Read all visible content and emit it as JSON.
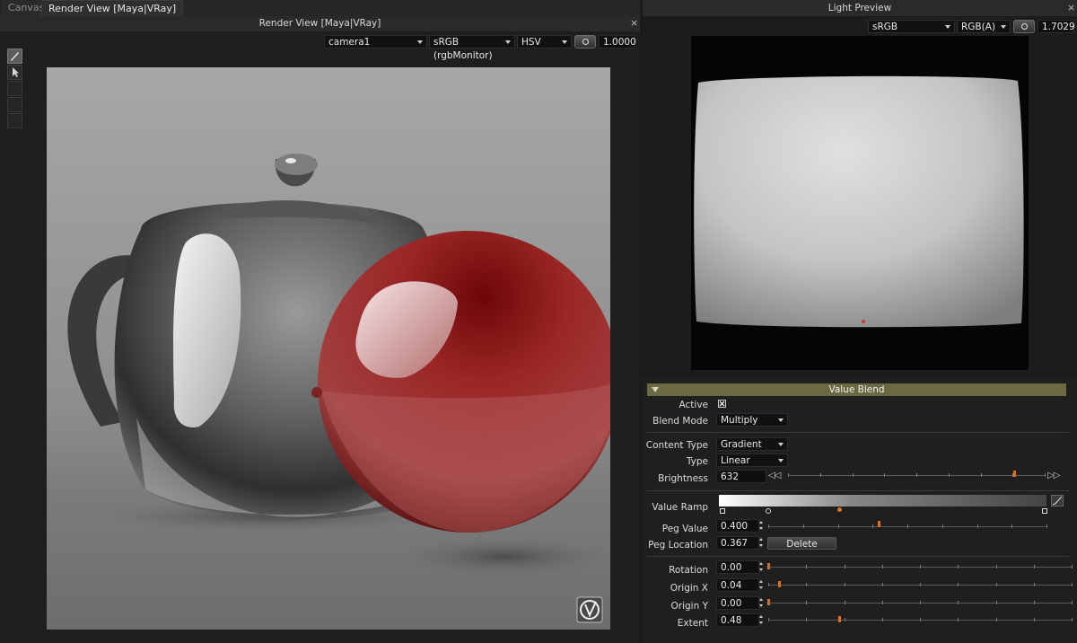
{
  "tabs": [
    {
      "label": "Canvas",
      "active": false
    },
    {
      "label": "Render View [Maya|VRay]",
      "active": true
    }
  ],
  "render_view": {
    "title": "Render View [Maya|VRay]",
    "close": "×",
    "camera": "camera1",
    "colorspace": "sRGB (rgbMonitor)",
    "channel": "HSV",
    "exposure": "1.0000"
  },
  "light_preview": {
    "title": "Light Preview",
    "close": "×",
    "colorspace": "sRGB (rgbMonitor)",
    "channel": "RGB(A)",
    "exposure": "1.7029"
  },
  "value_blend": {
    "title": "Value Blend",
    "active_label": "Active",
    "active_checked": true,
    "blend_mode_label": "Blend Mode",
    "blend_mode": "Multiply",
    "content_type_label": "Content Type",
    "content_type": "Gradient",
    "type_label": "Type",
    "type": "Linear",
    "brightness_label": "Brightness",
    "brightness": "632",
    "brightness_level": 0.88,
    "value_ramp_label": "Value Ramp",
    "peg_value_label": "Peg Value",
    "peg_value": "0.400",
    "peg_location_label": "Peg Location",
    "peg_location": "0.367",
    "delete_label": "Delete",
    "rotation_label": "Rotation",
    "rotation": "0.00",
    "origin_x_label": "Origin X",
    "origin_x": "0.04",
    "origin_y_label": "Origin Y",
    "origin_y": "0.00",
    "extent_label": "Extent",
    "extent": "0.48"
  },
  "colors": {
    "accent": "#e0701d",
    "header_olive": "#6b6942",
    "sphere_red": "#8b1c1c"
  },
  "icons": [
    "brush-icon",
    "pointer-icon",
    "exposure-icon",
    "vray-logo-icon"
  ]
}
